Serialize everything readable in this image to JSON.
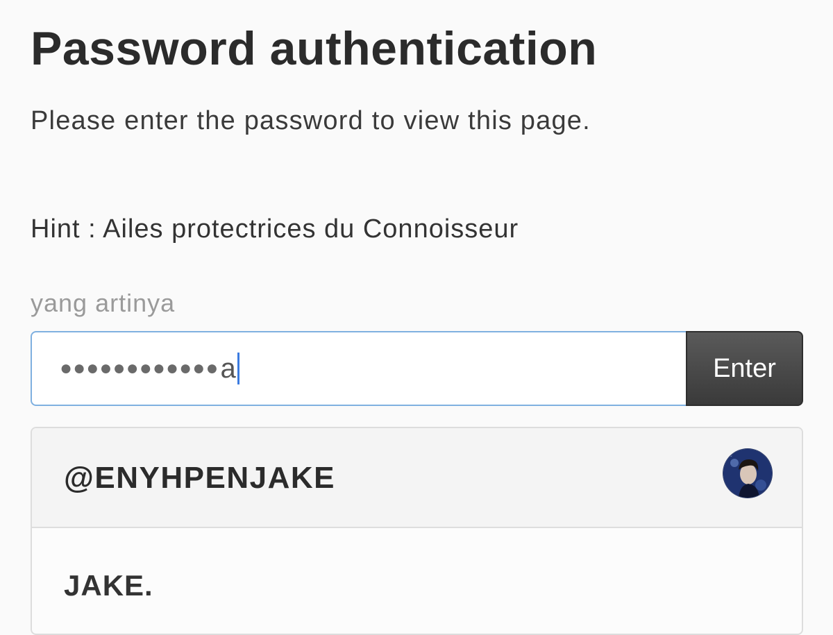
{
  "page": {
    "title": "Password authentication",
    "subtitle": "Please enter the password to view this page.",
    "hint": "Hint : Ailes protectrices du Connoisseur",
    "helper_text": "yang artinya"
  },
  "form": {
    "password_masked": "●●●●●●●●●●●●",
    "password_last_char": "a",
    "submit_label": "Enter"
  },
  "card": {
    "handle": "@ENYHPENJAKE",
    "name": "JAKE.",
    "avatar_icon": "profile-avatar"
  },
  "colors": {
    "background": "#fafafa",
    "input_focus_border": "#7fb0e0",
    "caret": "#3b7be0",
    "button_bg": "#474747",
    "button_text": "#ffffff",
    "card_header_bg": "#f4f4f4",
    "card_border": "#dddddd"
  }
}
